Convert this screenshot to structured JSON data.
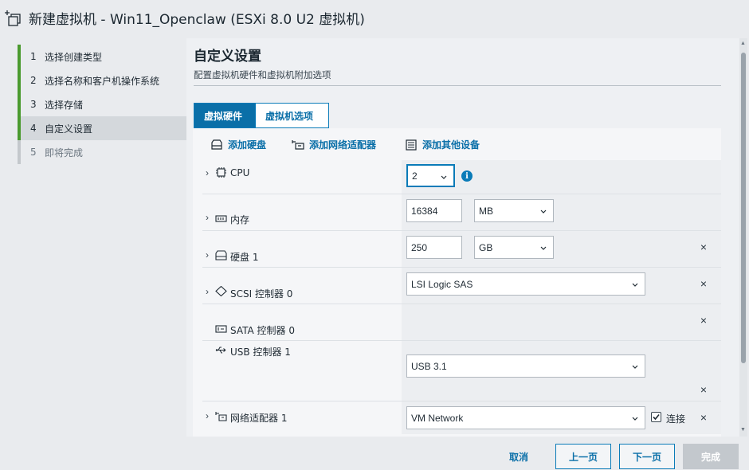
{
  "window": {
    "title": "新建虚拟机 - Win11_Openclaw (ESXi 8.0 U2 虚拟机)"
  },
  "nav": {
    "steps": [
      {
        "num": "1",
        "label": "选择创建类型",
        "state": "done"
      },
      {
        "num": "2",
        "label": "选择名称和客户机操作系统",
        "state": "done"
      },
      {
        "num": "3",
        "label": "选择存储",
        "state": "done"
      },
      {
        "num": "4",
        "label": "自定义设置",
        "state": "active"
      },
      {
        "num": "5",
        "label": "即将完成",
        "state": "pending"
      }
    ]
  },
  "main": {
    "heading": "自定义设置",
    "subheading": "配置虚拟机硬件和虚拟机附加选项",
    "tabs": [
      {
        "label": "虚拟硬件",
        "selected": true
      },
      {
        "label": "虚拟机选项",
        "selected": false
      }
    ],
    "toolbar": {
      "add_disk": "添加硬盘",
      "add_nic": "添加网络适配器",
      "add_other": "添加其他设备"
    },
    "devices": {
      "cpu": {
        "label": "CPU",
        "value": "2"
      },
      "memory": {
        "label": "内存",
        "value": "16384",
        "unit": "MB"
      },
      "disk": {
        "label": "硬盘 1",
        "value": "250",
        "unit": "GB"
      },
      "scsi": {
        "label": "SCSI 控制器 0",
        "value": "LSI Logic SAS"
      },
      "sata": {
        "label": "SATA 控制器 0"
      },
      "usb": {
        "label": "USB 控制器 1",
        "value": "USB 3.1"
      },
      "nic": {
        "label": "网络适配器 1",
        "value": "VM Network",
        "connect_label": "连接",
        "connected": true
      }
    },
    "remove_symbol": "×",
    "info_symbol": "i"
  },
  "footer": {
    "cancel": "取消",
    "back": "上一页",
    "next": "下一页",
    "finish": "完成"
  },
  "colors": {
    "accent": "#0a6fa8",
    "step_done": "#4a9a2e",
    "disabled": "#c3c8cd"
  }
}
